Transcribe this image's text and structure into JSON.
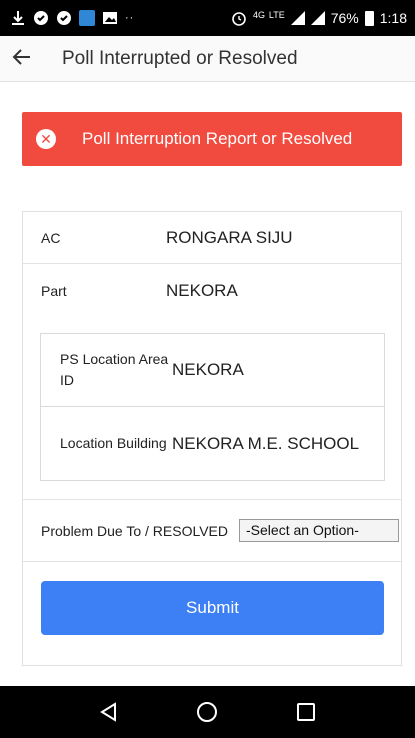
{
  "status_bar": {
    "network": "4G",
    "lte": "LTE",
    "battery": "76%",
    "time": "1:18"
  },
  "app_bar": {
    "title": "Poll Interrupted or Resolved"
  },
  "alert": {
    "text": "Poll Interruption Report or Resolved",
    "color": "#f14a3f"
  },
  "details": {
    "ac_label": "AC",
    "ac_value": "RONGARA SIJU",
    "part_label": "Part",
    "part_value": "NEKORA",
    "ps_location_label": "PS Location Area ID",
    "ps_location_value": "NEKORA",
    "location_building_label": "Location Building",
    "location_building_value": "NEKORA M.E. SCHOOL"
  },
  "problem": {
    "label": "Problem Due To / RESOLVED",
    "select_value": "-Select an Option-"
  },
  "submit": {
    "label": "Submit",
    "color": "#3d7ff5"
  },
  "icons": {
    "status_left": [
      "download-icon",
      "shield-icon",
      "shield-icon",
      "sync-app-icon",
      "image-icon",
      "more-dots-icon"
    ],
    "status_right": [
      "alarm-icon",
      "call-4g-icon",
      "signal-icon",
      "signal-icon",
      "battery-icon"
    ],
    "nav": [
      "back-triangle-icon",
      "home-circle-icon",
      "recents-square-icon"
    ]
  }
}
